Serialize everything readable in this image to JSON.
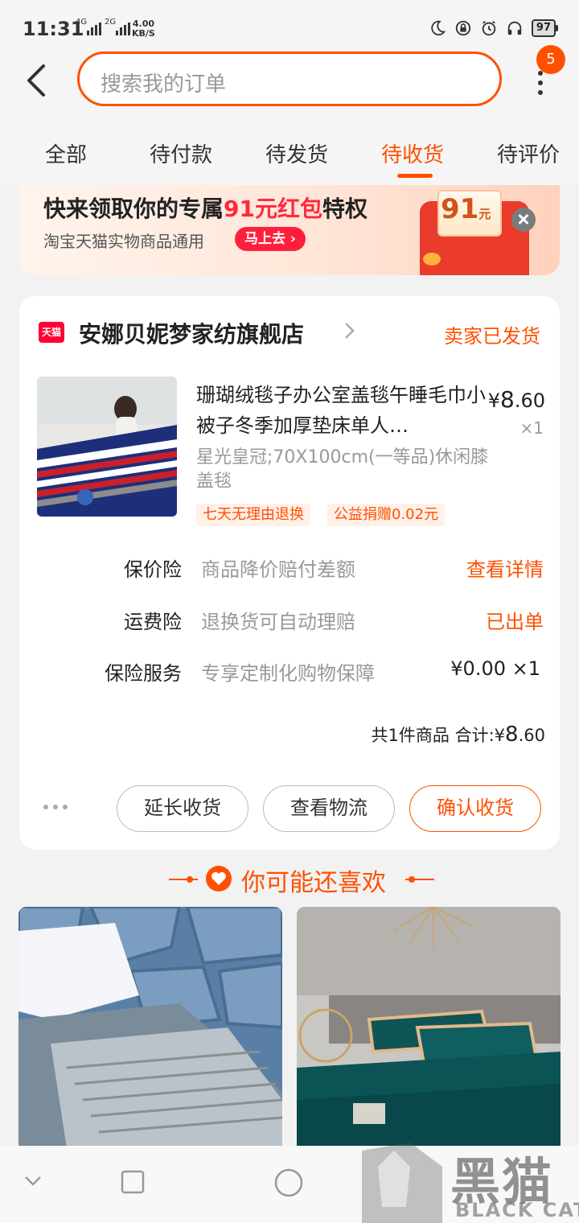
{
  "status_bar": {
    "time": "11:31",
    "network_top": "4G",
    "network_bottom": "2G",
    "speed_value": "4.00",
    "speed_unit": "KB/S",
    "battery": "97"
  },
  "header": {
    "search_placeholder": "搜索我的订单",
    "notification_count": "5"
  },
  "tabs": [
    {
      "label": "全部",
      "active": false
    },
    {
      "label": "待付款",
      "active": false
    },
    {
      "label": "待发货",
      "active": false
    },
    {
      "label": "待收货",
      "active": true
    },
    {
      "label": "待评价",
      "active": false
    }
  ],
  "promo": {
    "title_prefix": "快来领取你的专属",
    "title_highlight": "91元红包",
    "title_suffix": "特权",
    "subtitle": "淘宝天猫实物商品通用",
    "go_label": "马上去",
    "coupon_amount": "91",
    "coupon_unit": "元"
  },
  "order": {
    "shop_logo": "天猫",
    "shop_name": "安娜贝妮梦家纺旗舰店",
    "status": "卖家已发货",
    "product": {
      "title": "珊瑚绒毯子办公室盖毯午睡毛巾小被子冬季加厚垫床单人…",
      "price_symbol": "¥",
      "price_int": "8",
      "price_dec": ".60",
      "quantity": "×1",
      "sku": "星光皇冠;70X100cm(一等品)休闲膝盖毯",
      "tags": [
        "七天无理由退换",
        "公益捐赠0.02元"
      ]
    },
    "insurance": [
      {
        "label": "保价险",
        "desc": "商品降价赔付差额",
        "action": "查看详情"
      },
      {
        "label": "运费险",
        "desc": "退换货可自动理赔",
        "action": "已出单"
      },
      {
        "label": "保险服务",
        "desc": "专享定制化购物保障",
        "price": "¥0.00 ×1"
      }
    ],
    "total_prefix": "共1件商品 合计:",
    "total_symbol": "¥",
    "total_int": "8",
    "total_dec": ".60",
    "buttons": [
      "延长收货",
      "查看物流",
      "确认收货"
    ]
  },
  "recommend": {
    "title": "你可能还喜欢"
  },
  "watermark": {
    "cn": "黑猫",
    "en": "BLACK CAT"
  },
  "colors": {
    "accent": "#ff5000",
    "promo_red": "#ff2a3c"
  }
}
